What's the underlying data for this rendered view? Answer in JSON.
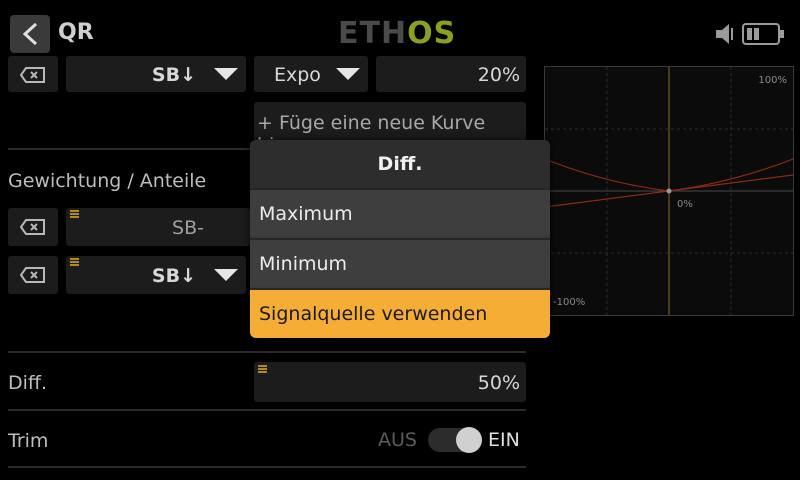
{
  "header": {
    "title": "QR",
    "logo_part1": "ETH",
    "logo_part2": "OS"
  },
  "panel": {
    "row1": {
      "source": "SB↓",
      "curve_type": "Expo",
      "curve_value": "20%"
    },
    "add_curve": "+ Füge eine neue Kurve hi...",
    "weight_section_label": "Gewichtung / Anteile",
    "weight_rows": [
      {
        "source": "SB-"
      },
      {
        "source": "SB↓"
      }
    ],
    "diff": {
      "label": "Diff.",
      "value": "50%"
    },
    "trim": {
      "label": "Trim",
      "off_label": "AUS",
      "on_label": "EIN",
      "state": "on"
    }
  },
  "graph": {
    "label_top": "100%",
    "label_center": "0%",
    "label_bottom": "-100%",
    "curve_color": "#8a2a14",
    "axis_color": "#8a6a20"
  },
  "dialog": {
    "title": "Diff.",
    "options": [
      {
        "label": "Maximum",
        "selected": false
      },
      {
        "label": "Minimum",
        "selected": false
      },
      {
        "label": "Signalquelle verwenden",
        "selected": true
      }
    ],
    "accent_color": "#f6ad36"
  }
}
